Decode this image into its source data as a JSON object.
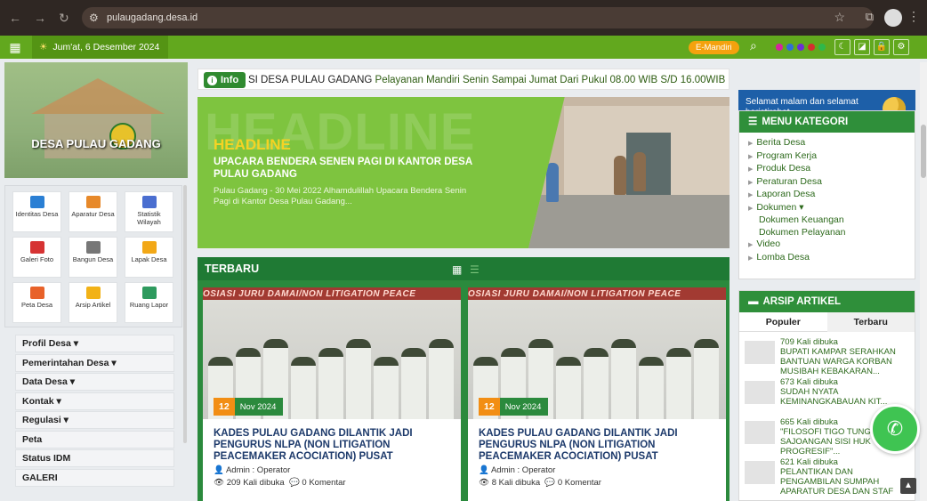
{
  "browser": {
    "url": "pulaugadang.desa.id",
    "nav_icons": [
      "back-icon",
      "forward-icon",
      "reload-icon"
    ]
  },
  "topbar": {
    "date": "Jum'at, 6 Desember 2024",
    "emandiri": "E-Mandiri",
    "theme_dots": [
      "#d6249f",
      "#2f6fd6",
      "#6c2fd6",
      "#d62f2f",
      "#2fb84a"
    ]
  },
  "sidebar": {
    "village_title": "DESA PULAU GADANG",
    "icons": [
      {
        "label": "Identitas Desa",
        "color": "#2a7fd4"
      },
      {
        "label": "Aparatur Desa",
        "color": "#e7892a"
      },
      {
        "label": "Statistik Wilayah",
        "color": "#4a6ed0"
      },
      {
        "label": "Galeri Foto",
        "color": "#d63333"
      },
      {
        "label": "Bangun Desa",
        "color": "#777777"
      },
      {
        "label": "Lapak Desa",
        "color": "#f2a817"
      },
      {
        "label": "Peta Desa",
        "color": "#e8622a"
      },
      {
        "label": "Arsip Artikel",
        "color": "#f2b217"
      },
      {
        "label": "Ruang Lapor",
        "color": "#2e9a5e"
      }
    ],
    "menu": [
      "Profil Desa ▾",
      "Pemerintahan Desa ▾",
      "Data Desa ▾",
      "Kontak ▾",
      "Regulasi ▾",
      "Peta",
      "Status IDM",
      "GALERI"
    ]
  },
  "ticker": {
    "label": "Info",
    "lead": "SI DESA PULAU GADANG",
    "message": " Pelayanan Mandiri Senin Sampai Jumat Dari Pukul 08.00 WIB S/D 16.00WIB"
  },
  "headline": {
    "bg_word": "HEADLINE",
    "label": "HEADLINE",
    "title": "UPACARA BENDERA SENEN PAGI DI KANTOR DESA PULAU GADANG",
    "desc": "Pulau Gadang - 30 Mei 2022 Alhamdulillah Upacara Bendera Senin Pagi di Kantor Desa Pulau Gadang..."
  },
  "terbaru": {
    "title": "TERBARU",
    "cards": [
      {
        "banner": "OSIASI JURU DAMAI/NON LITIGATION PEACE",
        "day": "12",
        "month": "Nov 2024",
        "title": "KADES PULAU GADANG DILANTIK JADI PENGURUS NLPA (NON LITIGATION PEACEMAKER ACOCIATION) PUSAT",
        "author": "Admin : Operator",
        "views": "209 Kali dibuka",
        "comments": "0 Komentar"
      },
      {
        "banner": "OSIASI JURU DAMAI/NON LITIGATION PEACE",
        "day": "12",
        "month": "Nov 2024",
        "title": "KADES PULAU GADANG DILANTIK JADI PENGURUS NLPA (NON LITIGATION PEACEMAKER ACOCIATION) PUSAT",
        "author": "Admin : Operator",
        "views": "8 Kali dibuka",
        "comments": "0 Komentar"
      }
    ]
  },
  "right": {
    "greeting": "Selamat malam dan selamat beristirahat",
    "kategori_title": "MENU KATEGORI",
    "kategori": [
      {
        "label": "Berita Desa",
        "sub": false
      },
      {
        "label": "Program Kerja",
        "sub": false
      },
      {
        "label": "Produk Desa",
        "sub": false
      },
      {
        "label": "Peraturan Desa",
        "sub": false
      },
      {
        "label": "Laporan Desa",
        "sub": false
      },
      {
        "label": "Dokumen ▾",
        "sub": false
      },
      {
        "label": "Dokumen Keuangan",
        "sub": true
      },
      {
        "label": "Dokumen Pelayanan",
        "sub": true
      },
      {
        "label": "Video",
        "sub": false
      },
      {
        "label": "Lomba Desa",
        "sub": false
      }
    ],
    "arsip_title": "ARSIP ARTIKEL",
    "tab_populer": "Populer",
    "tab_terbaru": "Terbaru",
    "articles": [
      {
        "views": "709 Kali dibuka",
        "title": "BUPATI KAMPAR SERAHKAN BANTUAN WARGA KORBAN MUSIBAH KEBAKARAN..."
      },
      {
        "views": "673 Kali dibuka",
        "title": "SUDAH NYATA KEMINANGKABAUAN KIT..."
      },
      {
        "views": "665 Kali dibuka",
        "title": "\"FILOSOFI TIGO TUNG SAJOANGAN SISI HUK PROGRESIF\"..."
      },
      {
        "views": "621 Kali dibuka",
        "title": "PELANTIKAN DAN PENGAMBILAN SUMPAH APARATUR DESA DAN STAF"
      }
    ]
  }
}
